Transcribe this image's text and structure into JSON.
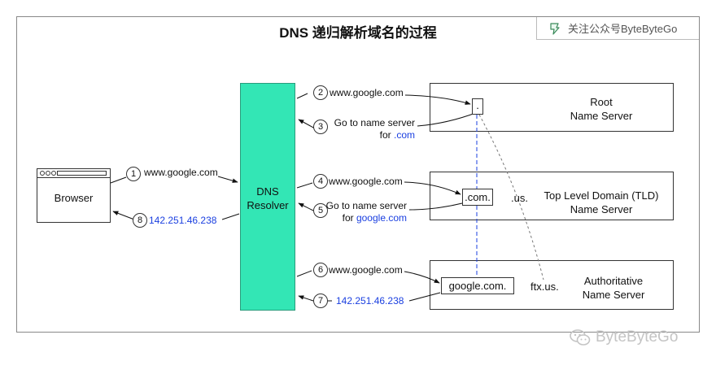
{
  "title": "DNS 递归解析域名的过程",
  "badge": {
    "text": "关注公众号ByteByteGo",
    "icon": "bytebytego-logo-icon"
  },
  "browser": {
    "label": "Browser"
  },
  "resolver": {
    "line1": "DNS",
    "line2": "Resolver"
  },
  "servers": {
    "root": {
      "line1": "Root",
      "line2": "Name Server",
      "inner": "."
    },
    "tld": {
      "line1": "Top Level Domain (TLD)",
      "line2": "Name Server",
      "inner": ".com.",
      "sibling": ".us."
    },
    "auth": {
      "line1": "Authoritative",
      "line2": "Name Server",
      "inner": "google.com.",
      "sibling": "ftx.us."
    }
  },
  "steps": [
    {
      "num": "1",
      "text": "www.google.com"
    },
    {
      "num": "2",
      "text": "www.google.com"
    },
    {
      "num": "3",
      "text_a": "Go to name server",
      "text_b_prefix": "for ",
      "text_b_link": ".com"
    },
    {
      "num": "4",
      "text": "www.google.com"
    },
    {
      "num": "5",
      "text_a": "Go to name server",
      "text_b_prefix": "for ",
      "text_b_link": "google.com"
    },
    {
      "num": "6",
      "text": "www.google.com"
    },
    {
      "num": "7",
      "text": "142.251.46.238"
    },
    {
      "num": "8",
      "text": "142.251.46.238"
    }
  ],
  "watermark": {
    "text": "ByteByteGo",
    "icon": "wechat-icon"
  },
  "colors": {
    "resolver": "#33e6b5",
    "link": "#1a3fe0",
    "tree_line": "#1a3fe0"
  }
}
